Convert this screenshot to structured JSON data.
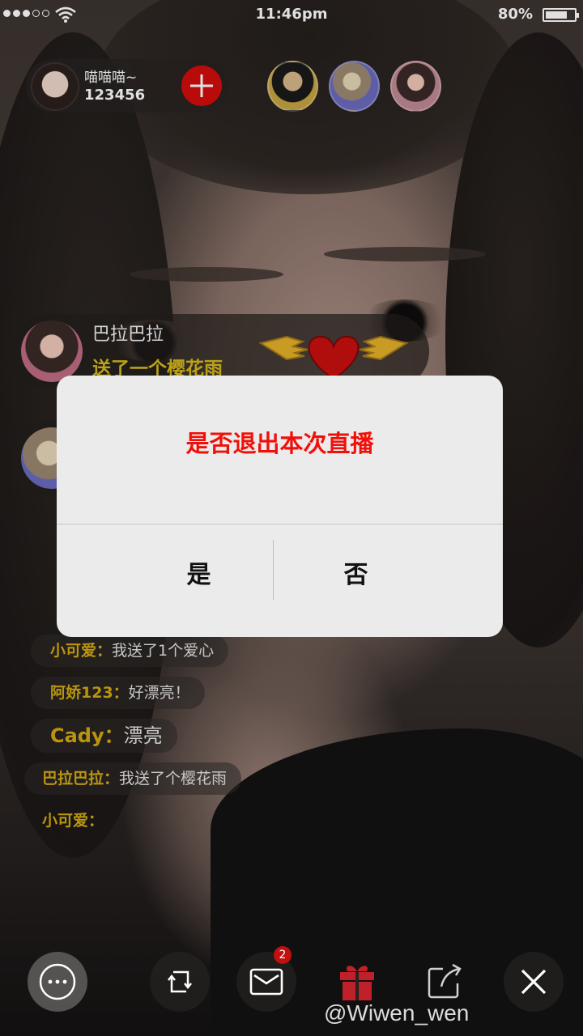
{
  "status_bar": {
    "signal_dots_filled": 3,
    "signal_dots_total": 5,
    "time": "11:46pm",
    "battery_percent": "80%",
    "battery_level": 0.8
  },
  "host": {
    "name": "喵喵喵~",
    "id": "123456",
    "follow_icon": "plus-icon"
  },
  "viewers": [
    "viewer-1",
    "viewer-2",
    "viewer-3"
  ],
  "gift_banners": [
    {
      "name": "巴拉巴拉",
      "message": "送了一个樱花雨"
    }
  ],
  "chat": [
    {
      "user": "小可爱：",
      "text": "我送了1个爱心"
    },
    {
      "user": "阿娇123：",
      "text": "好漂亮！"
    },
    {
      "user": "Cady：",
      "text": "漂亮"
    },
    {
      "user": "巴拉巴拉：",
      "text": "我送了个樱花雨"
    },
    {
      "user": "小可爱：",
      "text": ""
    }
  ],
  "dialog": {
    "message": "是否退出本次直播",
    "confirm_label": "是",
    "cancel_label": "否"
  },
  "toolbar": {
    "icons": [
      "chat-bubble-icon",
      "rotate-camera-icon",
      "mail-icon",
      "gift-icon",
      "share-icon",
      "close-icon"
    ],
    "mail_badge": "2"
  },
  "watermark": "@Wiwen_wen",
  "colors": {
    "dialog_message": "#f0100a",
    "username": "#d3aa12",
    "follow_button": "#d40d0d",
    "gift_icon": "#c0202a"
  }
}
